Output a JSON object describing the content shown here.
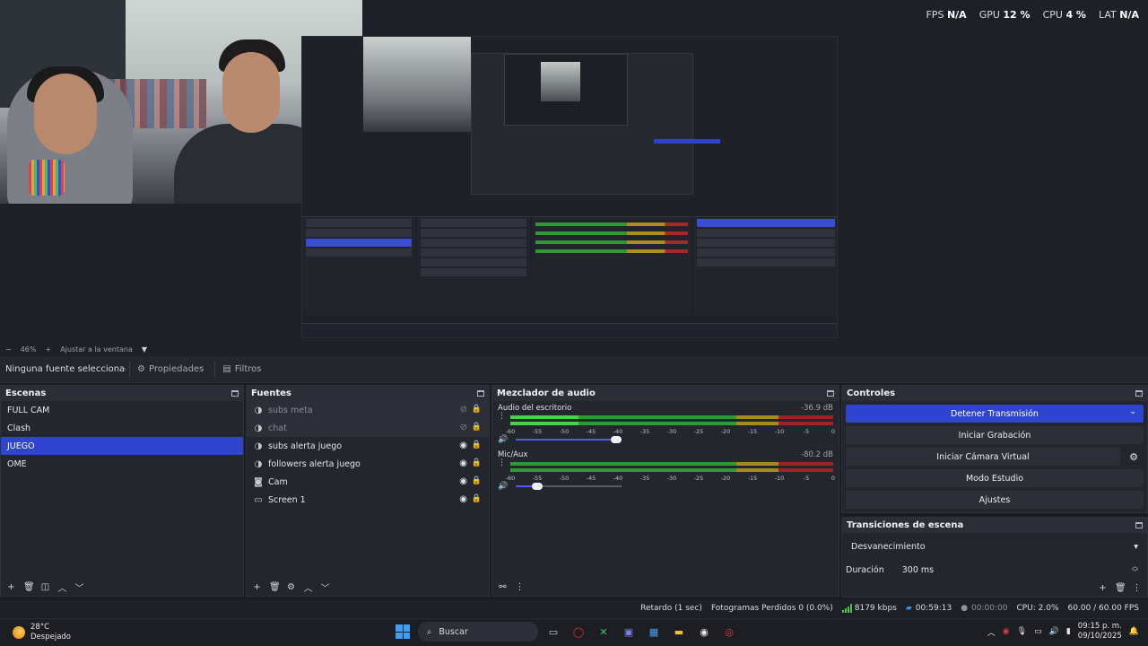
{
  "stats": {
    "fps_label": "FPS",
    "fps_value": "N/A",
    "gpu_label": "GPU",
    "gpu_value": "12 %",
    "cpu_label": "CPU",
    "cpu_value": "4 %",
    "lat_label": "LAT",
    "lat_value": "N/A"
  },
  "zoom": {
    "minus": "−",
    "value": "46%",
    "plus": "+",
    "fit_label": "Ajustar a la ventana"
  },
  "context": {
    "no_source": "Ninguna fuente seleccionada",
    "properties_label": "Propiedades",
    "filters_label": "Filtros"
  },
  "scenes": {
    "title": "Escenas",
    "items": [
      {
        "label": "FULL CAM"
      },
      {
        "label": "Clash"
      },
      {
        "label": "JUEGO",
        "selected": true
      },
      {
        "label": "OME"
      }
    ]
  },
  "sources": {
    "title": "Fuentes",
    "items": [
      {
        "label": "subs meta",
        "visible": false
      },
      {
        "label": "chat",
        "visible": false
      },
      {
        "label": "subs alerta juego",
        "visible": true
      },
      {
        "label": "followers alerta juego",
        "visible": true
      },
      {
        "label": "Cam",
        "visible": true
      },
      {
        "label": "Screen 1",
        "visible": true
      }
    ]
  },
  "mixer": {
    "title": "Mezclador de audio",
    "ticks": [
      "-60",
      "-55",
      "-50",
      "-45",
      "-40",
      "-35",
      "-30",
      "-25",
      "-20",
      "-15",
      "-10",
      "-5",
      "0"
    ],
    "channels": [
      {
        "name": "Audio del escritorio",
        "db": "-36.9 dB",
        "level": 0.21,
        "volume": 0.95
      },
      {
        "name": "Mic/Aux",
        "db": "-80.2 dB",
        "level": 0.0,
        "volume": 0.2
      }
    ]
  },
  "controls": {
    "title": "Controles",
    "stop_stream": "Detener Transmisión",
    "start_recording": "Iniciar Grabación",
    "start_virtual_cam": "Iniciar Cámara Virtual",
    "studio_mode": "Modo Estudio",
    "settings": "Ajustes"
  },
  "transitions": {
    "title": "Transiciones de escena",
    "selected": "Desvanecimiento",
    "duration_label": "Duración",
    "duration_value": "300 ms"
  },
  "status": {
    "delay": "Retardo (1 sec)",
    "dropped": "Fotogramas Perdidos 0 (0.0%)",
    "bitrate": "8179 kbps",
    "stream_time": "00:59:13",
    "rec_time": "00:00:00",
    "cpu": "CPU: 2.0%",
    "fps": "60.00 / 60.00 FPS"
  },
  "taskbar": {
    "temperature": "28°C",
    "weather": "Despejado",
    "search_label": "Buscar",
    "time": "09:15 p. m.",
    "date": "09/10/2025"
  },
  "colors": {
    "accent": "#2f44cf",
    "meter_green": "#2e9a34",
    "meter_yellow": "#a68a1e",
    "meter_red": "#9e2323"
  }
}
